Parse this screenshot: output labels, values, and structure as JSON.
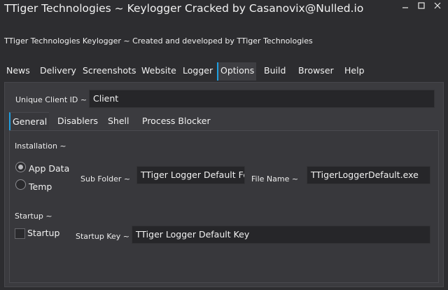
{
  "window": {
    "title": "TTiger Technologies ~ Keylogger Cracked by Casanovix@Nulled.io",
    "controls": {
      "minimize": "minimize",
      "maximize": "maximize",
      "close": "close"
    }
  },
  "subtitle": "TTiger Technologies Keylogger ~ Created and developed by TTiger Technologies",
  "nav": {
    "items": [
      {
        "label": "News"
      },
      {
        "label": "Delivery"
      },
      {
        "label": "Screenshots"
      },
      {
        "label": "Website"
      },
      {
        "label": "Logger"
      },
      {
        "label": "Options"
      },
      {
        "label": "Build"
      },
      {
        "label": "Browser"
      },
      {
        "label": "Help"
      }
    ],
    "active": "Options"
  },
  "options": {
    "client_id_label": "Unique Client ID ~",
    "client_id_value": "Client",
    "tabs": [
      {
        "label": "General"
      },
      {
        "label": "Disablers"
      },
      {
        "label": "Shell"
      },
      {
        "label": "Process Blocker"
      }
    ],
    "active_tab": "General",
    "general": {
      "installation_heading": "Installation ~",
      "radio_app_data": "App Data",
      "radio_temp": "Temp",
      "selected_location": "App Data",
      "sub_folder_label": "Sub Folder ~",
      "sub_folder_value": "TTiger Logger Default Fo",
      "file_name_label": "File Name ~",
      "file_name_value": "TTigerLoggerDefault.exe",
      "startup_heading": "Startup ~",
      "startup_checkbox_label": "Startup",
      "startup_checked": false,
      "startup_key_label": "Startup Key ~",
      "startup_key_value": "TTiger Logger Default Key"
    }
  },
  "colors": {
    "background": "#2d2d30",
    "panel": "#3b3b3f",
    "textbox": "#262629",
    "accent": "#1e9fe0"
  }
}
